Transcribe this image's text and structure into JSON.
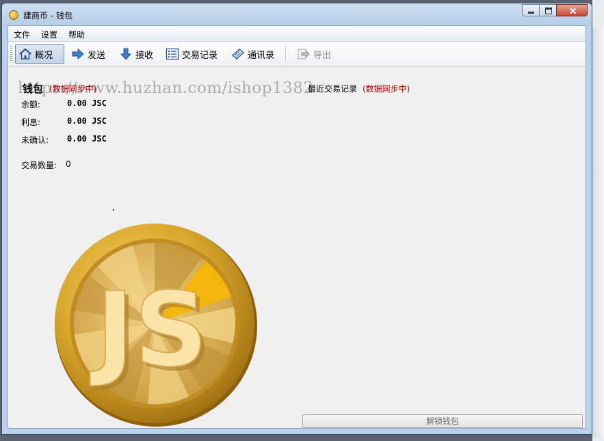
{
  "window": {
    "title": "建商币 - 钱包"
  },
  "menu": {
    "items": [
      "文件",
      "设置",
      "帮助"
    ]
  },
  "toolbar": {
    "buttons": [
      {
        "label": "概况",
        "icon": "home-icon",
        "active": true
      },
      {
        "label": "发送",
        "icon": "send-arrow-icon"
      },
      {
        "label": "接收",
        "icon": "receive-arrow-icon"
      },
      {
        "label": "交易记录",
        "icon": "list-icon"
      },
      {
        "label": "通讯录",
        "icon": "address-book-icon"
      },
      {
        "label": "导出",
        "icon": "export-icon",
        "disabled": true
      }
    ]
  },
  "wallet": {
    "title": "钱包",
    "sync_status": "(数据同步中)",
    "balance_label": "余额:",
    "balance_value": "0.00 JSC",
    "interest_label": "利息:",
    "interest_value": "0.00 JSC",
    "unconfirmed_label": "未确认:",
    "unconfirmed_value": "0.00 JSC",
    "tx_count_label": "交易数量:",
    "tx_count_value": "0"
  },
  "recent": {
    "title": "最近交易记录",
    "sync_status": "(数据同步中)"
  },
  "coin": {
    "letters": "JS"
  },
  "unlock_button": {
    "label": "解锁钱包"
  },
  "watermark": {
    "text": "https://www.huzhan.com/ishop1382"
  },
  "colors": {
    "sync_red": "#b00000",
    "coin_gold": "#d8a72a",
    "title_bar": "#b9d1ea"
  }
}
